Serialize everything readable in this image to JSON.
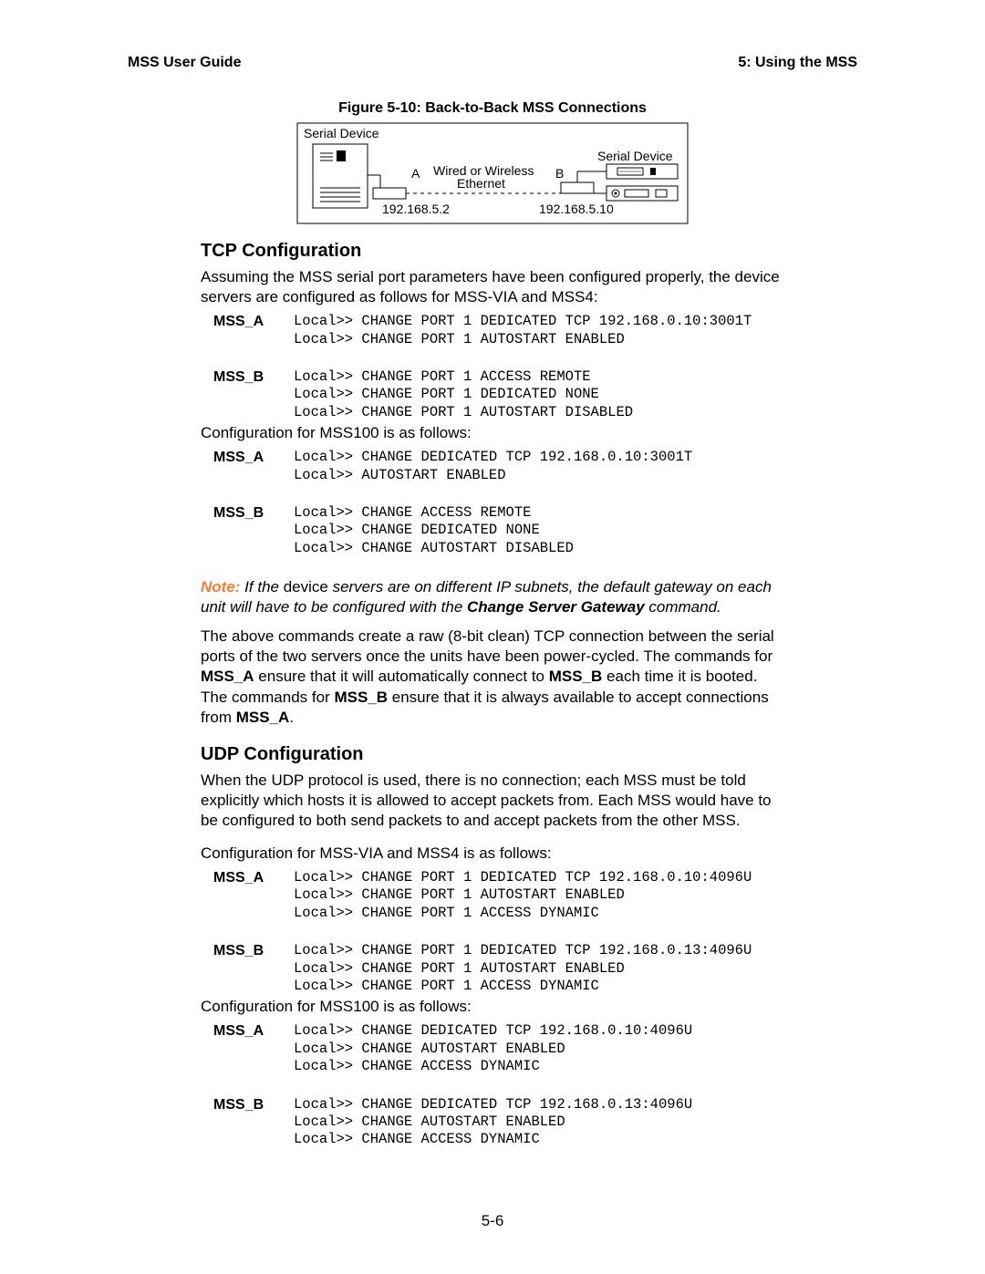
{
  "header": {
    "left": "MSS User Guide",
    "right": "5:  Using the MSS"
  },
  "figure": {
    "caption": "Figure 5-10:  Back-to-Back MSS Connections",
    "top_left_label": "Serial Device",
    "top_right_label": "Serial Device",
    "mid_label_line1": "Wired or Wireless",
    "mid_label_line2": "Ethernet",
    "a_label": "A",
    "b_label": "B",
    "ip_left": "192.168.5.2",
    "ip_right": "192.168.5.10"
  },
  "sections": {
    "tcp": {
      "heading": "TCP Configuration",
      "intro": "Assuming the MSS serial port parameters have been configured properly, the device servers are configured as follows for MSS-VIA and MSS4:",
      "rows1": [
        {
          "label": "MSS_A",
          "code": "Local>> CHANGE PORT 1 DEDICATED TCP 192.168.0.10:3001T\nLocal>> CHANGE PORT 1 AUTOSTART ENABLED"
        },
        {
          "label": "MSS_B",
          "code": "Local>> CHANGE PORT 1 ACCESS REMOTE\nLocal>> CHANGE PORT 1 DEDICATED NONE\nLocal>> CHANGE PORT 1 AUTOSTART DISABLED"
        }
      ],
      "mid_para": "Configuration for MSS100 is as follows:",
      "rows2": [
        {
          "label": "MSS_A",
          "code": "Local>> CHANGE DEDICATED TCP 192.168.0.10:3001T\nLocal>> AUTOSTART ENABLED"
        },
        {
          "label": "MSS_B",
          "code": "Local>> CHANGE ACCESS REMOTE\nLocal>> CHANGE DEDICATED NONE\nLocal>> CHANGE AUTOSTART DISABLED"
        }
      ],
      "note_label": "Note:",
      "note_pre": " If the ",
      "note_device": "device",
      "note_post1": " servers are on different IP subnets, the default gateway on each unit will have to be configured with the ",
      "note_bold": "Change Server Gateway",
      "note_post2": " command.",
      "para2_pre": "The above commands create a raw (8-bit clean) TCP connection between the serial ports of the two servers once the units have been power-cycled. The commands for ",
      "para2_b1": "MSS_A",
      "para2_mid1": " ensure that it will automatically connect to ",
      "para2_b2": "MSS_B",
      "para2_mid2": " each time it is booted. The commands for ",
      "para2_b3": "MSS_B",
      "para2_mid3": " ensure that it is always available to accept connections from ",
      "para2_b4": "MSS_A",
      "para2_end": "."
    },
    "udp": {
      "heading": "UDP Configuration",
      "intro": "When the UDP protocol is used, there is no connection; each MSS must be told explicitly which hosts it is allowed to accept packets from. Each MSS would have to be configured to both send packets to and accept packets from the other MSS.",
      "para2": "Configuration for MSS-VIA and MSS4 is as follows:",
      "rows1": [
        {
          "label": "MSS_A",
          "code": "Local>> CHANGE PORT 1 DEDICATED TCP 192.168.0.10:4096U\nLocal>> CHANGE PORT 1 AUTOSTART ENABLED\nLocal>> CHANGE PORT 1 ACCESS DYNAMIC"
        },
        {
          "label": "MSS_B",
          "code": "Local>> CHANGE PORT 1 DEDICATED TCP 192.168.0.13:4096U\nLocal>> CHANGE PORT 1 AUTOSTART ENABLED\nLocal>> CHANGE PORT 1 ACCESS DYNAMIC"
        }
      ],
      "mid_para": "Configuration for MSS100 is as follows:",
      "rows2": [
        {
          "label": "MSS_A",
          "code": "Local>> CHANGE DEDICATED TCP 192.168.0.10:4096U\nLocal>> CHANGE AUTOSTART ENABLED\nLocal>> CHANGE ACCESS DYNAMIC"
        },
        {
          "label": "MSS_B",
          "code": "Local>> CHANGE DEDICATED TCP 192.168.0.13:4096U\nLocal>> CHANGE AUTOSTART ENABLED\nLocal>> CHANGE ACCESS DYNAMIC"
        }
      ]
    }
  },
  "pagenum": "5-6"
}
